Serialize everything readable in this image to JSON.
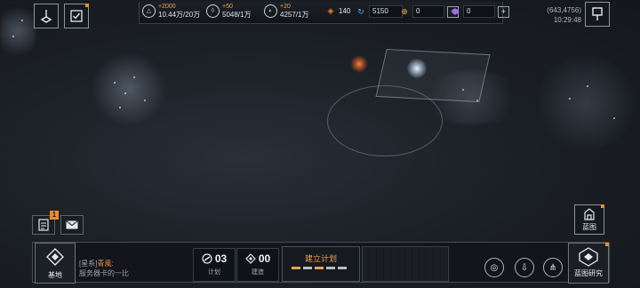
{
  "resources": [
    {
      "gain": "+2000",
      "amount": "10.44万/20万"
    },
    {
      "gain": "+50",
      "amount": "5048/1万"
    },
    {
      "gain": "+20",
      "amount": "4257/1万"
    }
  ],
  "chips": [
    {
      "value": "140"
    },
    {
      "value": "5150"
    },
    {
      "value": "0"
    },
    {
      "value": "0"
    }
  ],
  "status": {
    "coords": "(643,4756)",
    "time": "10:29:48"
  },
  "blueprint_button": {
    "label": "蓝图"
  },
  "notifications": {
    "mail_badge": "1"
  },
  "bottom_bar": {
    "base_label": "基地",
    "chat_channel": "[星系]",
    "chat_sender": "青風:",
    "chat_message": "服务器卡的一比",
    "plan_count": {
      "value": "03",
      "label": "计划"
    },
    "build_count": {
      "value": "00",
      "label": "建造"
    },
    "build_plan_label": "建立计划",
    "blueprint_research_label": "蓝图研究"
  },
  "colors": {
    "accent": "#f08a2a",
    "border": "#8c9399"
  }
}
